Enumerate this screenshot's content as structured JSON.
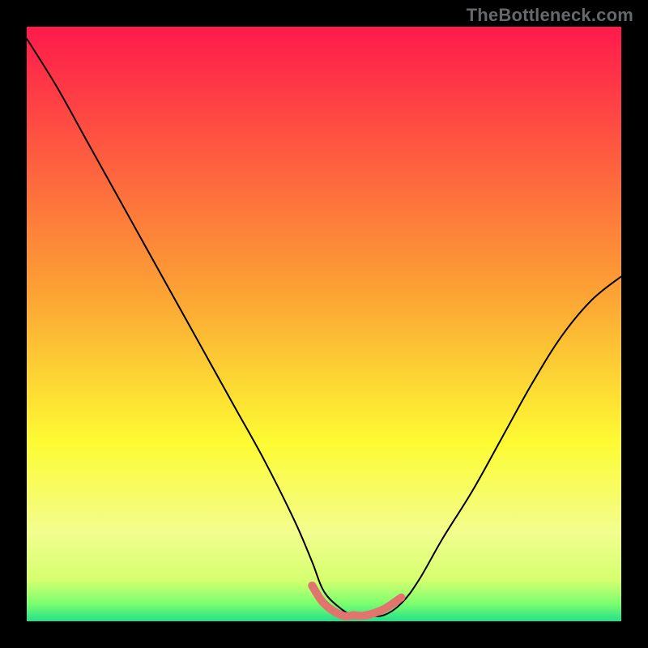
{
  "watermark": "TheBottleneck.com",
  "chart_data": {
    "type": "line",
    "title": "",
    "xlabel": "",
    "ylabel": "",
    "xlim": [
      0,
      100
    ],
    "ylim": [
      0,
      100
    ],
    "axes_visible": false,
    "grid": false,
    "background_gradient_stops": [
      {
        "offset": 0.0,
        "color": "#ff1a4b"
      },
      {
        "offset": 0.45,
        "color": "#fca334"
      },
      {
        "offset": 0.7,
        "color": "#fdfb33"
      },
      {
        "offset": 0.85,
        "color": "#f3fd8e"
      },
      {
        "offset": 0.93,
        "color": "#d6ff70"
      },
      {
        "offset": 0.97,
        "color": "#7dff6e"
      },
      {
        "offset": 1.0,
        "color": "#22e08a"
      }
    ],
    "series": [
      {
        "name": "bottleneck-curve",
        "stroke": "#000000",
        "stroke_width": 2,
        "x": [
          0,
          5,
          10,
          15,
          20,
          25,
          30,
          35,
          40,
          45,
          48,
          50,
          53,
          55,
          57,
          60,
          63,
          66,
          70,
          75,
          80,
          85,
          90,
          95,
          100
        ],
        "y": [
          98,
          90,
          81,
          72,
          63,
          54,
          45,
          36,
          27,
          17,
          10,
          5,
          2,
          1,
          1,
          1,
          3,
          7,
          14,
          22,
          31,
          40,
          48,
          54,
          58
        ]
      },
      {
        "name": "highlight-band",
        "stroke": "#e2736d",
        "stroke_width": 10,
        "linecap": "round",
        "x": [
          48,
          50,
          53,
          55,
          57,
          60,
          63
        ],
        "y": [
          6,
          3,
          1,
          1,
          1,
          2,
          4
        ]
      }
    ]
  }
}
